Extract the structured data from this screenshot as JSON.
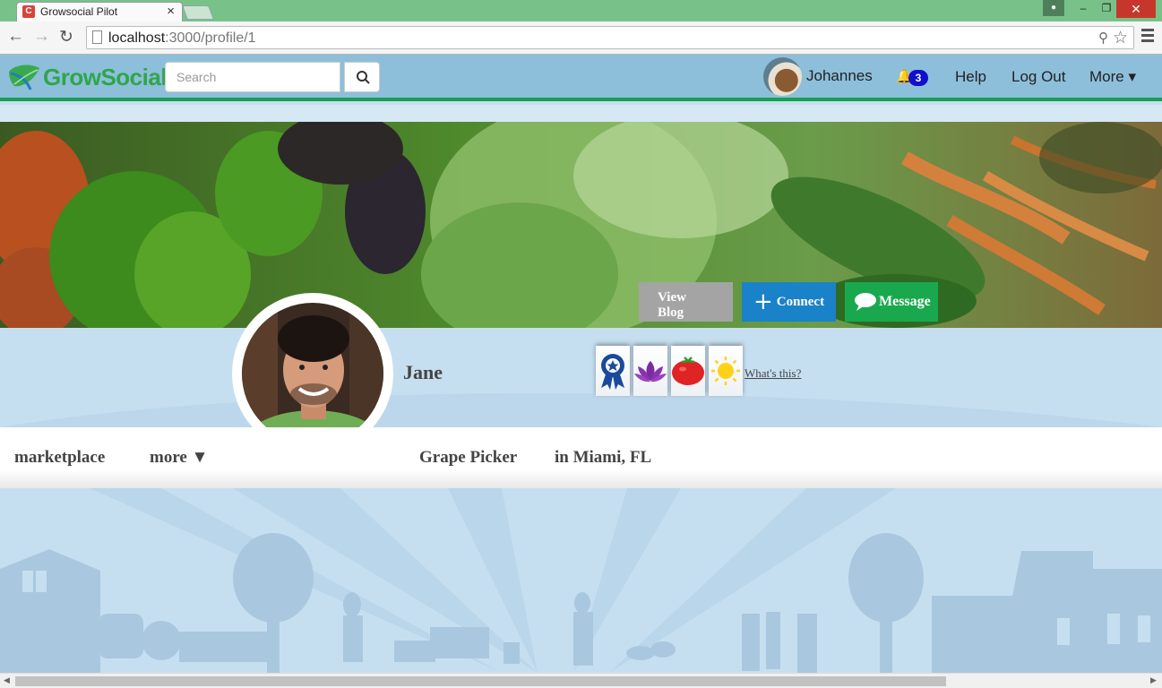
{
  "browser": {
    "tab_title": "Growsocial Pilot",
    "tab_close": "×",
    "url_host": "localhost",
    "url_path": ":3000/profile/1"
  },
  "navbar": {
    "logo_text_1": "Grow",
    "logo_text_2": "Social",
    "search_placeholder": "Search",
    "username": "Johannes",
    "notifications_count": "3",
    "help_label": "Help",
    "logout_label": "Log Out",
    "more_label": "More ▾"
  },
  "actions": {
    "view_blog_line1": "View",
    "view_blog_line2": "Blog",
    "connect_label": "Connect",
    "message_label": "Message"
  },
  "profile": {
    "name": "Jane",
    "whats_this": "What's this?",
    "badges": [
      "ribbon-icon",
      "lotus-icon",
      "tomato-icon",
      "sun-icon"
    ]
  },
  "strip": {
    "marketplace": "marketplace",
    "more": "more ▼",
    "occupation": "Grape Picker",
    "location": "in Miami, FL"
  },
  "colors": {
    "nav_bg": "#8dbfdb",
    "nav_border": "#1a9f4d",
    "connect": "#1a82c8",
    "message": "#1aa84f",
    "view_blog": "#a4a4a4",
    "page_bg": "#c6dff0"
  }
}
